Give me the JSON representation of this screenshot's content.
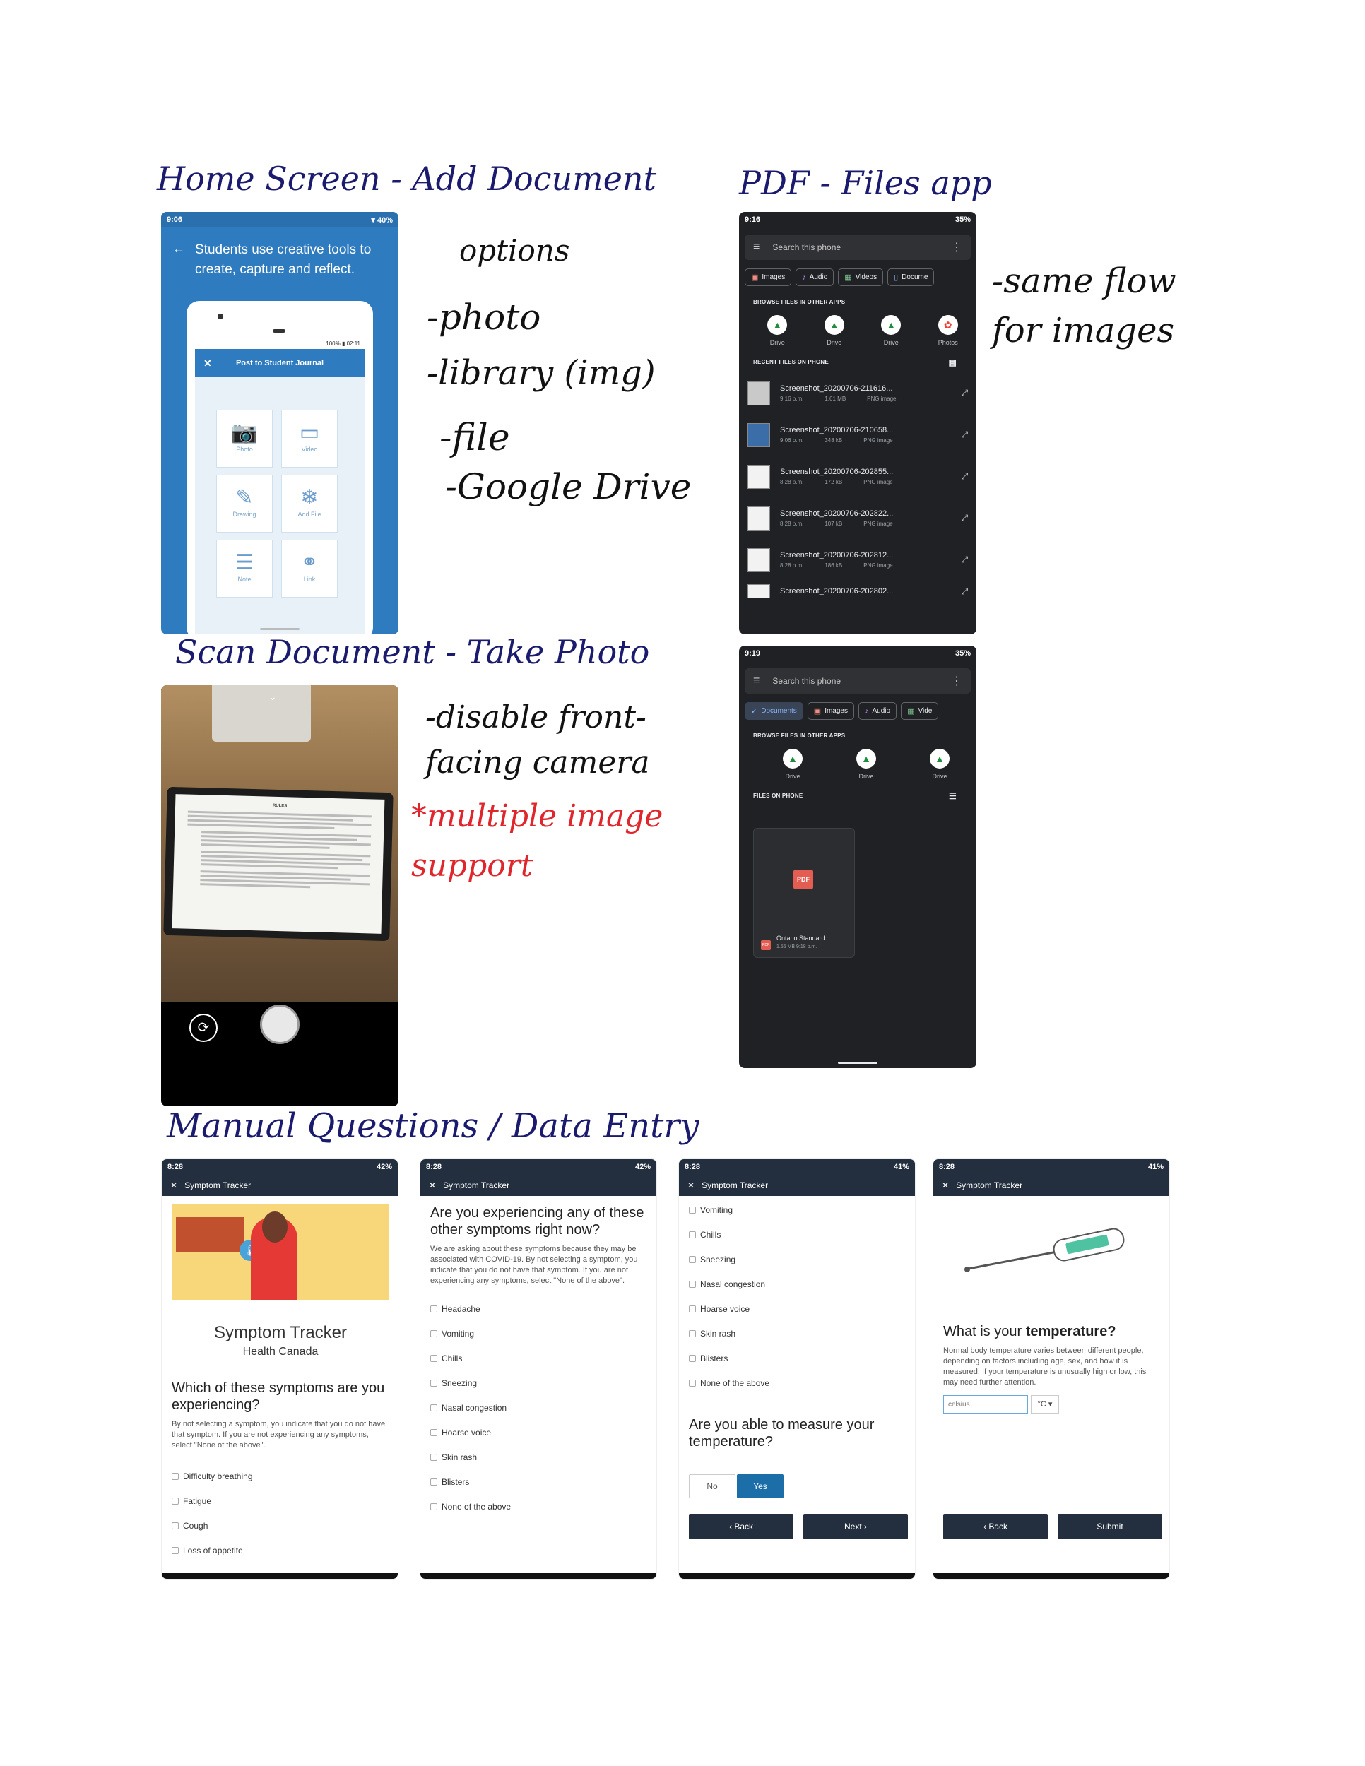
{
  "annotations": {
    "home_screen_title": "Home Screen - Add Document",
    "pdf_title": "PDF - Files app",
    "scan_title": "Scan Document - Take Photo",
    "manual_title": "Manual Questions / Data Entry",
    "options_heading": "options",
    "options": [
      "-photo",
      "-library (img)",
      "-file",
      "-Google Drive"
    ],
    "same_flow": [
      "-same flow",
      "for images"
    ],
    "camera_notes": [
      "-disable front-",
      "facing camera"
    ],
    "multiple_image": [
      "*multiple image",
      "support"
    ]
  },
  "home_phone": {
    "time": "9:06",
    "battery": "40%",
    "header": "Students use creative tools to create, capture and reflect.",
    "inner_status": "100% ▮ 02:11",
    "inner_title": "Post to Student Journal",
    "tiles": [
      {
        "label": "Photo",
        "icon": "camera-icon"
      },
      {
        "label": "Video",
        "icon": "video-icon"
      },
      {
        "label": "Drawing",
        "icon": "pencil-icon"
      },
      {
        "label": "Add File",
        "icon": "file-icon"
      },
      {
        "label": "Note",
        "icon": "note-icon"
      },
      {
        "label": "Link",
        "icon": "link-icon"
      }
    ]
  },
  "files_phone": {
    "time": "9:16",
    "battery": "35%",
    "search_placeholder": "Search this phone",
    "chips": [
      "Images",
      "Audio",
      "Videos",
      "Docume"
    ],
    "browse_label": "BROWSE FILES IN OTHER APPS",
    "apps": [
      "Drive",
      "Drive",
      "Drive",
      "Photos"
    ],
    "recent_label": "RECENT FILES ON PHONE",
    "files": [
      {
        "name": "Screenshot_20200706-211616...",
        "time": "9:16 p.m.",
        "size": "1.61 MB",
        "type": "PNG image"
      },
      {
        "name": "Screenshot_20200706-210658...",
        "time": "9:06 p.m.",
        "size": "348 kB",
        "type": "PNG image"
      },
      {
        "name": "Screenshot_20200706-202855...",
        "time": "8:28 p.m.",
        "size": "172 kB",
        "type": "PNG image"
      },
      {
        "name": "Screenshot_20200706-202822...",
        "time": "8:28 p.m.",
        "size": "107 kB",
        "type": "PNG image"
      },
      {
        "name": "Screenshot_20200706-202812...",
        "time": "8:28 p.m.",
        "size": "186 kB",
        "type": "PNG image"
      },
      {
        "name": "Screenshot_20200706-202802...",
        "time": "",
        "size": "",
        "type": ""
      }
    ]
  },
  "files_phone2": {
    "time": "9:19",
    "battery": "35%",
    "search_placeholder": "Search this phone",
    "chips": [
      "Documents",
      "Images",
      "Audio",
      "Vide"
    ],
    "browse_label": "BROWSE FILES IN OTHER APPS",
    "apps": [
      "Drive",
      "Drive",
      "Drive"
    ],
    "files_label": "FILES ON PHONE",
    "pdf_badge": "PDF",
    "pdf_name": "Ontario Standard...",
    "pdf_meta": "1.55 MB 9:18 p.m."
  },
  "camera_phone": {
    "doc_title": "RULES"
  },
  "symptom1": {
    "time": "8:28",
    "battery": "42%",
    "bar_title": "Symptom Tracker",
    "app_title": "Symptom Tracker",
    "org": "Health Canada",
    "question": "Which of these symptoms are you experiencing?",
    "desc": "By not selecting a symptom, you indicate that you do not have that symptom. If you are not experiencing any symptoms, select \"None of the above\".",
    "options": [
      "Difficulty breathing",
      "Fatigue",
      "Cough",
      "Loss of appetite"
    ]
  },
  "symptom2": {
    "time": "8:28",
    "battery": "42%",
    "bar_title": "Symptom Tracker",
    "question": "Are you experiencing any of these other symptoms right now?",
    "desc": "We are asking about these symptoms because they may be associated with COVID-19. By not selecting a symptom, you indicate that you do not have that symptom. If you are not experiencing any symptoms, select \"None of the above\".",
    "options": [
      "Headache",
      "Vomiting",
      "Chills",
      "Sneezing",
      "Nasal congestion",
      "Hoarse voice",
      "Skin rash",
      "Blisters",
      "None of the above"
    ]
  },
  "symptom3": {
    "time": "8:28",
    "battery": "41%",
    "bar_title": "Symptom Tracker",
    "options": [
      "Vomiting",
      "Chills",
      "Sneezing",
      "Nasal congestion",
      "Hoarse voice",
      "Skin rash",
      "Blisters",
      "None of the above"
    ],
    "question": "Are you able to measure your temperature?",
    "no": "No",
    "yes": "Yes",
    "back": "‹ Back",
    "next": "Next ›"
  },
  "symptom4": {
    "time": "8:28",
    "battery": "41%",
    "bar_title": "Symptom Tracker",
    "question_pre": "What is your",
    "question_bold": "temperature?",
    "desc": "Normal body temperature varies between different people, depending on factors including age, sex, and how it is measured. If your temperature is unusually high or low, this may need further attention.",
    "input_placeholder": "celsius",
    "unit": "°C ▾",
    "back": "‹ Back",
    "submit": "Submit"
  }
}
